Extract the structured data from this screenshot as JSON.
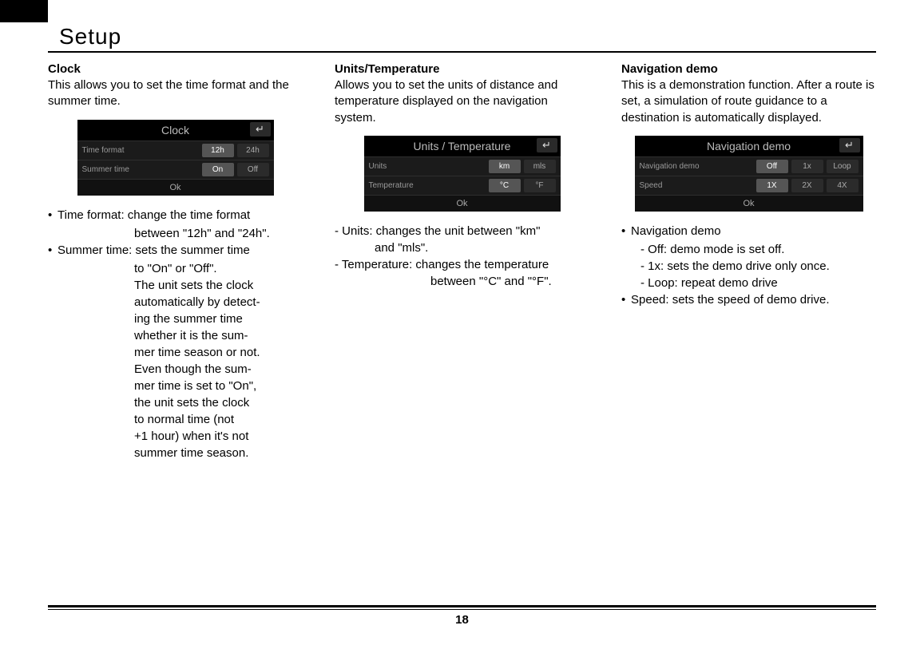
{
  "page_title": "Setup",
  "page_number": "18",
  "col1": {
    "heading": "Clock",
    "desc": "This allows you to set the time format and the summer time.",
    "screenshot": {
      "title": "Clock",
      "back": "↵",
      "rows": [
        {
          "label": "Time format",
          "opts": [
            "12h",
            "24h"
          ],
          "sel": 0
        },
        {
          "label": "Summer time",
          "opts": [
            "On",
            "Off"
          ],
          "sel": 0
        }
      ],
      "footer": "Ok"
    },
    "bul1": "Time format: change the time format",
    "bul1b": "between \"12h\" and \"24h\".",
    "bul2": "Summer time: sets the summer time",
    "bul2_lines": [
      "to \"On\" or \"Off\".",
      "The unit sets the clock",
      "automatically by detect-",
      "ing the summer time",
      "whether it is the sum-",
      "mer time season or not.",
      "Even though the sum-",
      "mer time is set to \"On\",",
      "the unit sets the clock",
      "to normal time (not",
      "+1 hour) when it's not",
      "summer time season."
    ]
  },
  "col2": {
    "heading": "Units/Temperature",
    "desc": "Allows you to set the units of distance and temperature displayed on the navigation system.",
    "screenshot": {
      "title": "Units / Temperature",
      "back": "↵",
      "rows": [
        {
          "label": "Units",
          "opts": [
            "km",
            "mls"
          ],
          "sel": 0
        },
        {
          "label": "Temperature",
          "opts": [
            "°C",
            "°F"
          ],
          "sel": 0
        }
      ],
      "footer": "Ok"
    },
    "d1": "- Units: changes the unit between \"km\"",
    "d1b": "and \"mls\".",
    "d2": "- Temperature: changes the temperature",
    "d2b": "between \"°C\" and \"°F\"."
  },
  "col3": {
    "heading": "Navigation demo",
    "desc": "This is a demonstration function. After a route is set, a simulation of route guidance to a destination is automatically displayed.",
    "screenshot": {
      "title": "Navigation demo",
      "back": "↵",
      "rows": [
        {
          "label": "Navigation demo",
          "opts": [
            "Off",
            "1x",
            "Loop"
          ],
          "sel": 0
        },
        {
          "label": "Speed",
          "opts": [
            "1X",
            "2X",
            "4X"
          ],
          "sel": 0
        }
      ],
      "footer": "Ok"
    },
    "b1": "Navigation demo",
    "s1": "- Off: demo mode is set off.",
    "s2": "- 1x: sets the demo drive only once.",
    "s3": "- Loop: repeat demo drive",
    "b2": "Speed: sets the speed of demo drive."
  }
}
